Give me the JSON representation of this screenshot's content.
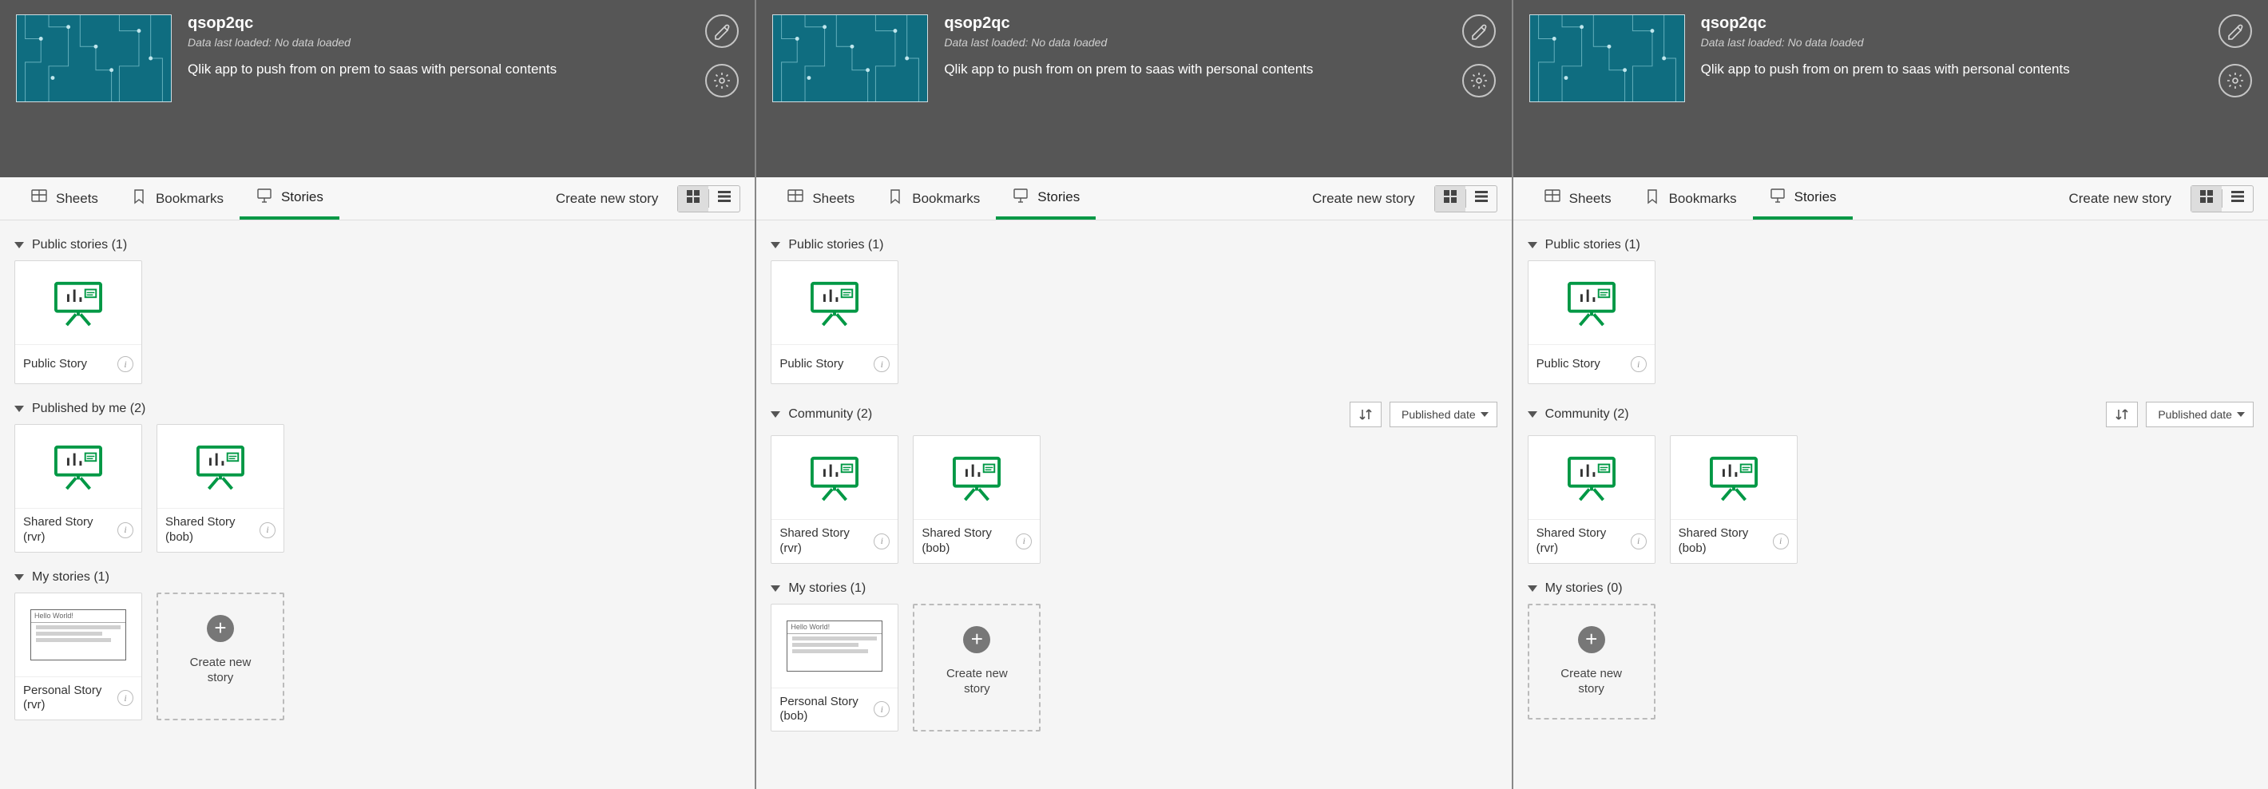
{
  "app": {
    "title": "qsop2qc",
    "meta": "Data last loaded: No data loaded",
    "desc": "Qlik app to push from on prem to saas with personal contents"
  },
  "tabs": {
    "sheets": "Sheets",
    "bookmarks": "Bookmarks",
    "stories": "Stories",
    "create": "Create new story"
  },
  "sort_label": "Published date",
  "create_card": "Create new\nstory",
  "plus": "+",
  "info_glyph": "i",
  "mini_title": "Hello World!",
  "panels": [
    {
      "sections": [
        {
          "title": "Public stories (1)",
          "controls": false,
          "cards": [
            {
              "kind": "story",
              "label": "Public Story"
            }
          ]
        },
        {
          "title": "Published by me (2)",
          "controls": false,
          "cards": [
            {
              "kind": "story",
              "label": "Shared Story (rvr)"
            },
            {
              "kind": "story",
              "label": "Shared Story (bob)"
            }
          ]
        },
        {
          "title": "My stories (1)",
          "controls": false,
          "cards": [
            {
              "kind": "personal",
              "label": "Personal Story (rvr)"
            },
            {
              "kind": "create"
            }
          ]
        }
      ]
    },
    {
      "sections": [
        {
          "title": "Public stories (1)",
          "controls": false,
          "cards": [
            {
              "kind": "story",
              "label": "Public Story"
            }
          ]
        },
        {
          "title": "Community (2)",
          "controls": true,
          "cards": [
            {
              "kind": "story",
              "label": "Shared Story (rvr)"
            },
            {
              "kind": "story",
              "label": "Shared Story (bob)"
            }
          ]
        },
        {
          "title": "My stories (1)",
          "controls": false,
          "cards": [
            {
              "kind": "personal",
              "label": "Personal Story (bob)"
            },
            {
              "kind": "create"
            }
          ]
        }
      ]
    },
    {
      "sections": [
        {
          "title": "Public stories (1)",
          "controls": false,
          "cards": [
            {
              "kind": "story",
              "label": "Public Story"
            }
          ]
        },
        {
          "title": "Community (2)",
          "controls": true,
          "cards": [
            {
              "kind": "story",
              "label": "Shared Story (rvr)"
            },
            {
              "kind": "story",
              "label": "Shared Story (bob)"
            }
          ]
        },
        {
          "title": "My stories (0)",
          "controls": false,
          "cards": [
            {
              "kind": "create"
            }
          ]
        }
      ]
    }
  ]
}
